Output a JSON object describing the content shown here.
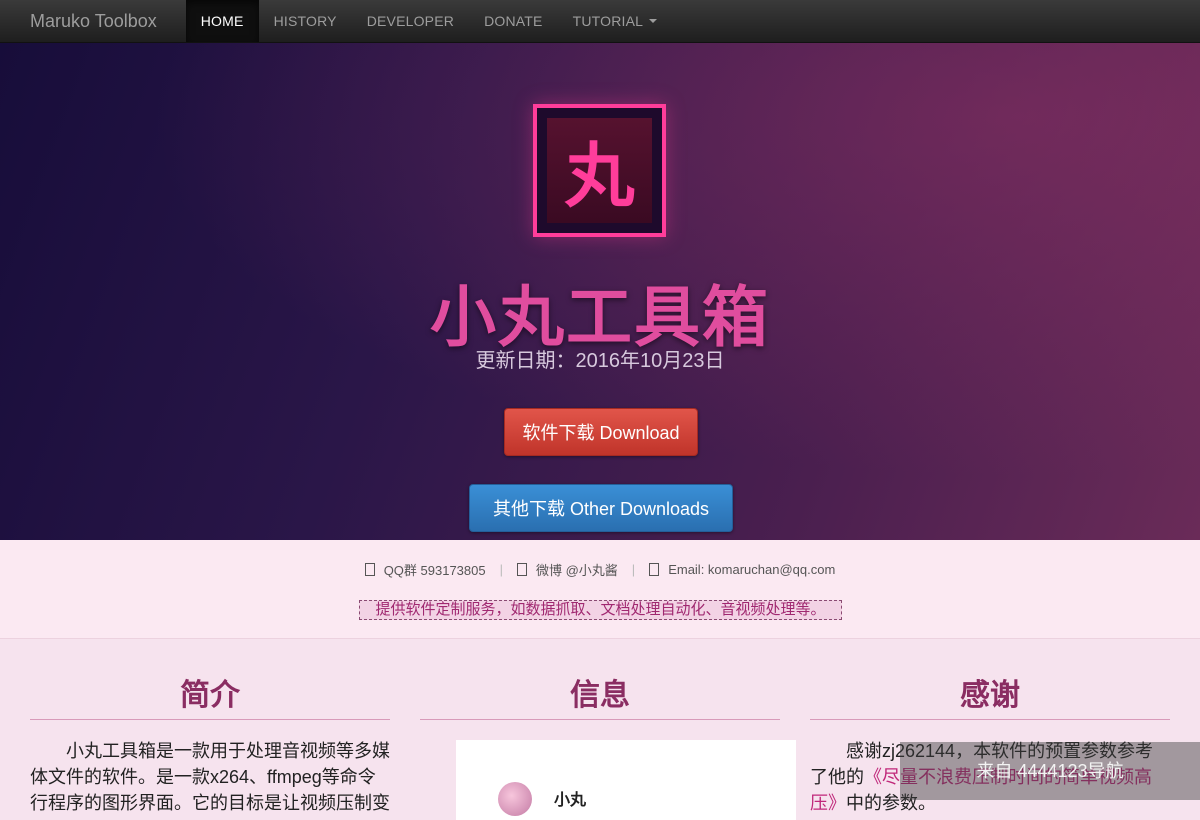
{
  "navbar": {
    "brand": "Maruko Toolbox",
    "items": [
      "HOME",
      "HISTORY",
      "DEVELOPER",
      "DONATE",
      "TUTORIAL"
    ]
  },
  "hero": {
    "logo_char": "丸",
    "title": "小丸工具箱",
    "update_line": "更新日期：2016年10月23日",
    "download_button": "软件下载 Download",
    "other_downloads_button": "其他下载 Other Downloads"
  },
  "contact": {
    "qq": "QQ群 593173805",
    "weibo": "微博 @小丸酱",
    "email": "Email: komaruchan@qq.com",
    "services": "提供软件定制服务，如数据抓取、文档处理自动化、音视频处理等。"
  },
  "columns": {
    "intro": {
      "heading": "简介",
      "text": "小丸工具箱是一款用于处理音视频等多媒体文件的软件。是一款x264、ffmpeg等命令行程序的图形界面。它的目标是让视频压制变"
    },
    "info": {
      "heading": "信息",
      "card_name": "小丸"
    },
    "thanks": {
      "heading": "感谢",
      "text_before": "感谢zj262144，本软件的预置参数参考了他的",
      "link_text": "《尽量不浪费压制时间的简单视频高压》",
      "text_after": "中的参数。"
    }
  },
  "watermark": "来自 4444123导航",
  "colors": {
    "accent_pink": "#e04d9e",
    "download_red": "#c9372c",
    "other_blue": "#2f7cc2"
  }
}
